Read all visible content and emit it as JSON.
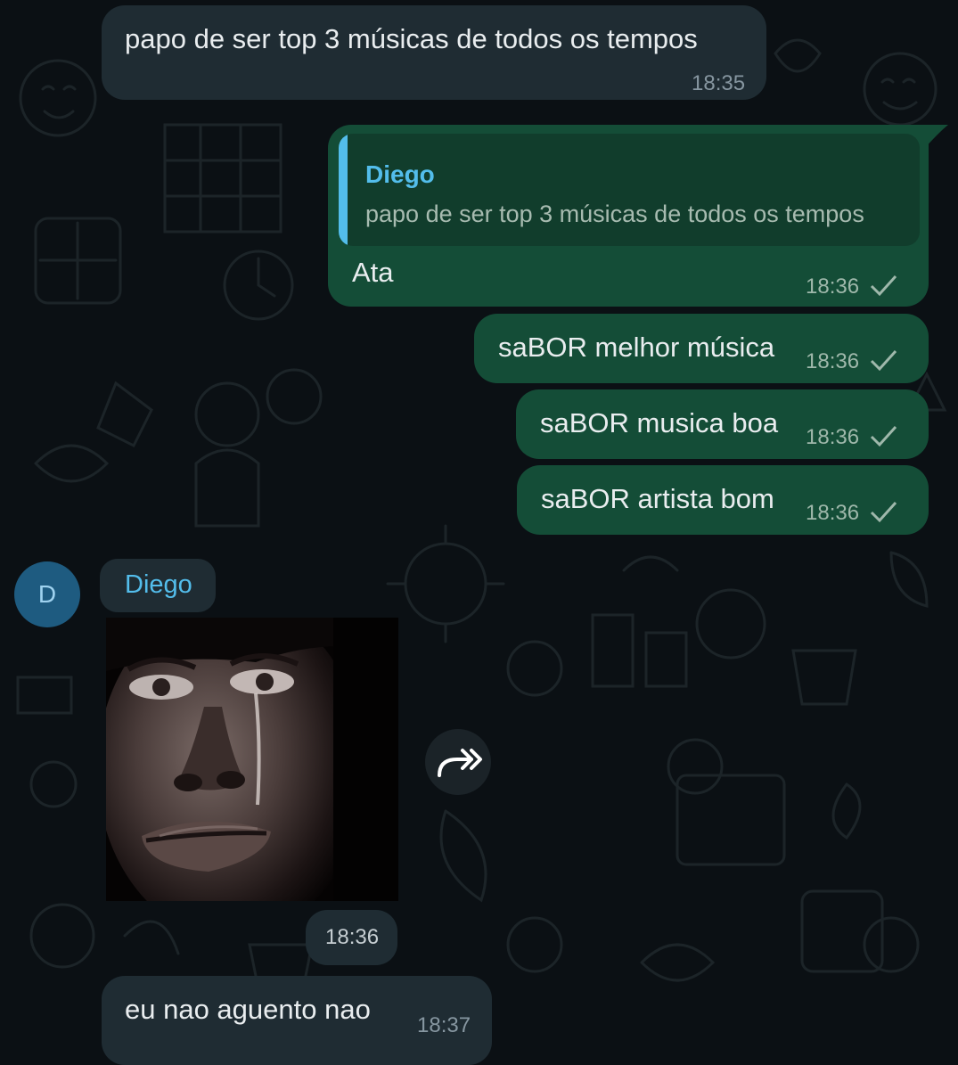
{
  "messages": [
    {
      "direction": "in",
      "text": "papo de ser top 3 músicas de todos os tempos",
      "time": "18:35"
    },
    {
      "direction": "out",
      "quote_author": "Diego",
      "quote_text": "papo de ser top 3 músicas de todos os tempos",
      "text": "Ata",
      "time": "18:36",
      "status": "sent-check"
    },
    {
      "direction": "out",
      "text": "saBOR melhor música",
      "time": "18:36",
      "status": "sent-check"
    },
    {
      "direction": "out",
      "text": "saBOR musica boa",
      "time": "18:36",
      "status": "sent-check"
    },
    {
      "direction": "out",
      "text": "saBOR artista bom",
      "time": "18:36",
      "status": "sent-check"
    },
    {
      "direction": "in",
      "sender": "Diego",
      "avatar_letter": "D",
      "media": "image",
      "time": "18:36"
    },
    {
      "direction": "in",
      "text": "eu nao aguento nao",
      "time": "18:37"
    }
  ],
  "icons": {
    "check": "single-check-icon",
    "forward": "forward-icon"
  },
  "colors": {
    "background": "#0b1014",
    "incoming_bubble": "#1f2c33",
    "outgoing_bubble": "#144d37",
    "accent_blue": "#53bdeb",
    "avatar_bg": "#1e5b80"
  }
}
